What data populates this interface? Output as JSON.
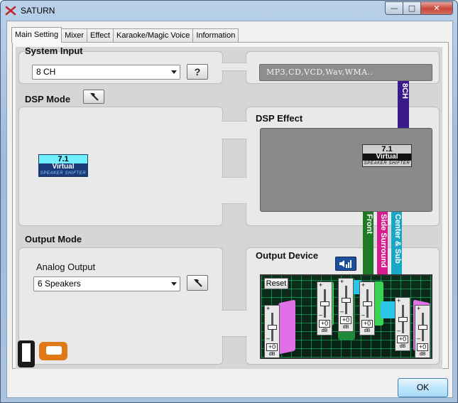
{
  "window": {
    "title": "SATURN",
    "controls": [
      "—",
      "□",
      "✕"
    ]
  },
  "tabs": [
    "Main Setting",
    "Mixer",
    "Effect",
    "Karaoke/Magic Voice",
    "Information"
  ],
  "system_input": {
    "title": "System Input",
    "selected": "8 CH",
    "help_label": "?",
    "sources": "MP3,CD,VCD,Wav,WMA.."
  },
  "dsp_mode": {
    "title": "DSP Mode",
    "logo": {
      "line1": "7.1",
      "line2": "Virtual",
      "line3": "SPEAKER SHIFTER"
    }
  },
  "dsp_effect": {
    "title": "DSP Effect",
    "logo": {
      "line1": "7.1",
      "line2": "Virtual",
      "line3": "SPEAKER SHIFTER"
    }
  },
  "channel_bars": {
    "input": "8CH",
    "front": "Front",
    "side": "Side Surround",
    "center": "Center & Sub"
  },
  "output_mode": {
    "title": "Output Mode",
    "sub_title": "Analog Output",
    "selected": "6 Speakers"
  },
  "output_device": {
    "title": "Output Device",
    "reset_label": "Reset",
    "sliders": [
      {
        "plus": "+",
        "minus": "–",
        "value": "+0",
        "unit": "dB",
        "level": 0.5
      },
      {
        "plus": "+",
        "minus": "–",
        "value": "+0",
        "unit": "dB",
        "level": 0.5
      },
      {
        "plus": "+",
        "minus": "–",
        "value": "+0",
        "unit": "dB",
        "level": 0.5
      },
      {
        "plus": "+",
        "minus": "–",
        "value": "+0",
        "unit": "dB",
        "level": 0.5
      },
      {
        "plus": "+",
        "minus": "–",
        "value": "+0",
        "unit": "dB",
        "level": 0.5
      },
      {
        "plus": "+",
        "minus": "–",
        "value": "+0",
        "unit": "dB",
        "level": 0.5
      }
    ]
  },
  "buttons": {
    "ok": "OK"
  },
  "colors": {
    "bar_8ch": "#3a1a8a",
    "bar_front": "#1f7a24",
    "bar_side": "#d81b8e",
    "bar_center": "#18a7c4",
    "speaker_pink": "#e070e8",
    "speaker_green": "#39d353",
    "speaker_cyan": "#29c6e8"
  }
}
